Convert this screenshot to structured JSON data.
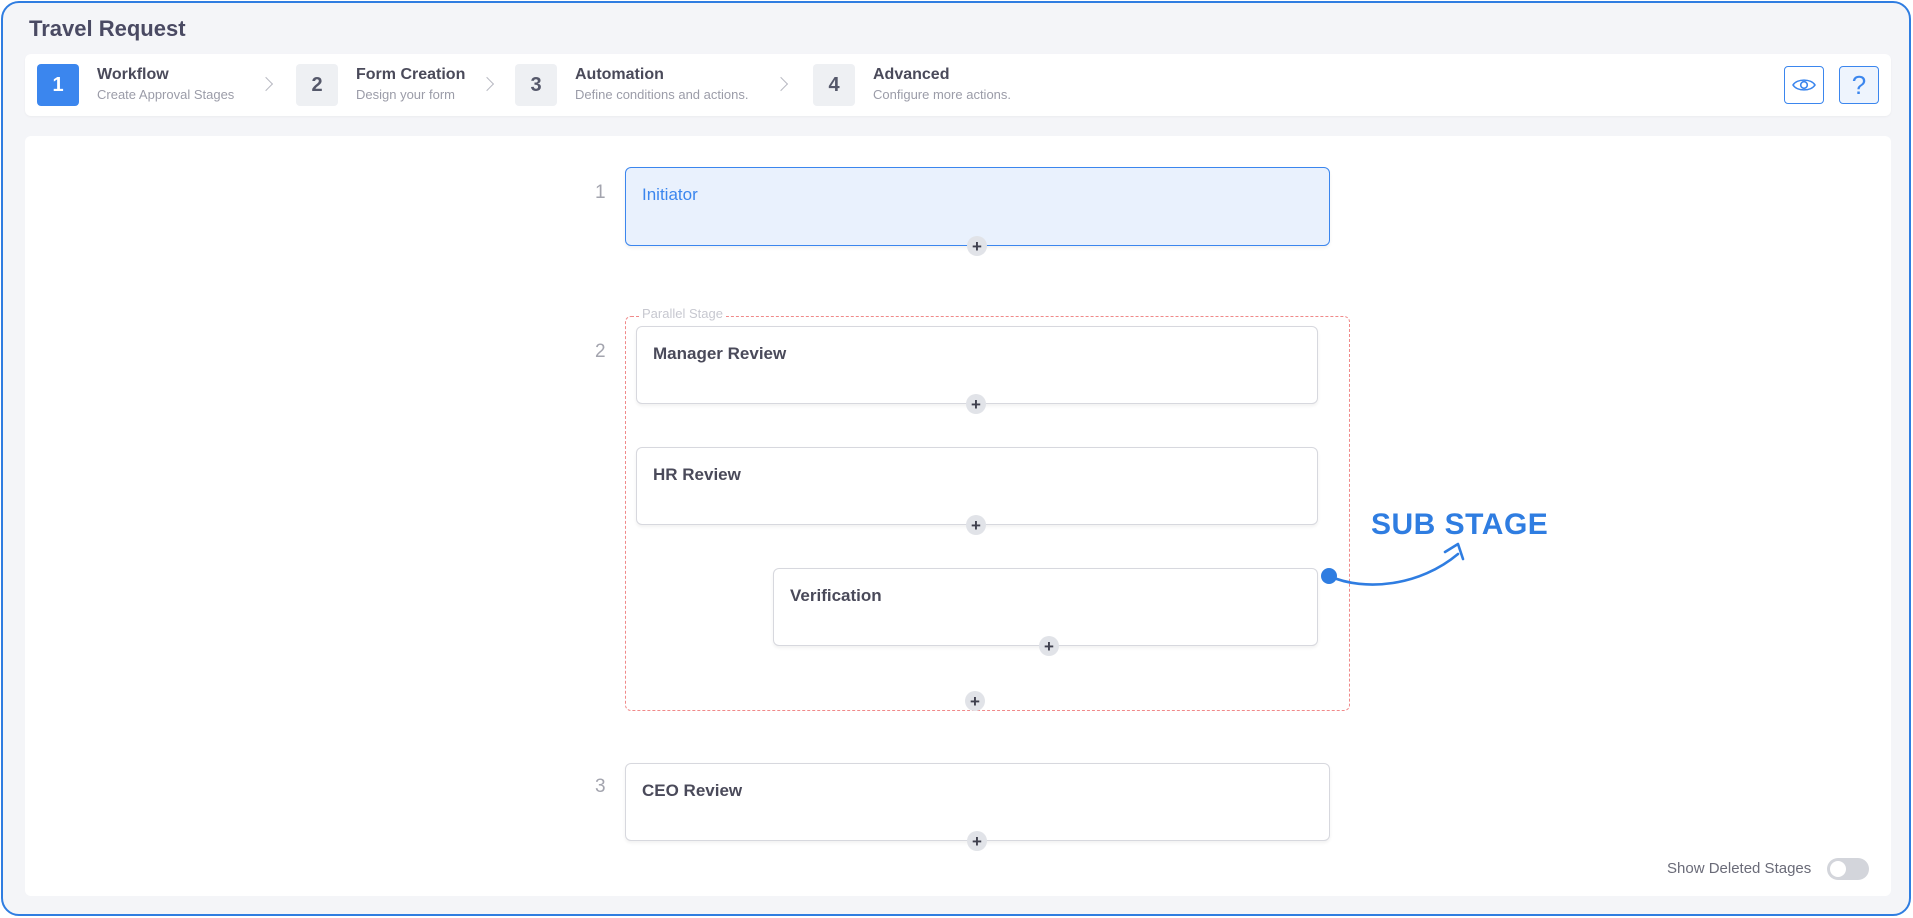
{
  "app": {
    "title": "Travel Request"
  },
  "stepper": {
    "steps": [
      {
        "number": "1",
        "title": "Workflow",
        "subtitle": "Create Approval Stages"
      },
      {
        "number": "2",
        "title": "Form Creation",
        "subtitle": "Design your form"
      },
      {
        "number": "3",
        "title": "Automation",
        "subtitle": "Define conditions and actions."
      },
      {
        "number": "4",
        "title": "Advanced",
        "subtitle": "Configure more actions."
      }
    ],
    "active_step": 1,
    "preview_icon": "eye-icon",
    "help_icon": "question-icon",
    "help_glyph": "?"
  },
  "workflow": {
    "stages": [
      {
        "number": "1",
        "name": "Initiator"
      },
      {
        "number": "2",
        "group_label": "Parallel Stage",
        "cards": [
          {
            "name": "Manager Review"
          },
          {
            "name": "HR Review"
          },
          {
            "name": "Verification",
            "sub_stage": true
          }
        ]
      },
      {
        "number": "3",
        "name": "CEO Review"
      }
    ],
    "add_glyph": "+"
  },
  "annotation": {
    "text": "SUB STAGE"
  },
  "footer": {
    "show_deleted_label": "Show Deleted Stages",
    "show_deleted_on": false
  },
  "colors": {
    "accent": "#3b86ee",
    "frame": "#2f7de1",
    "parallel_border": "#f08a8a"
  }
}
